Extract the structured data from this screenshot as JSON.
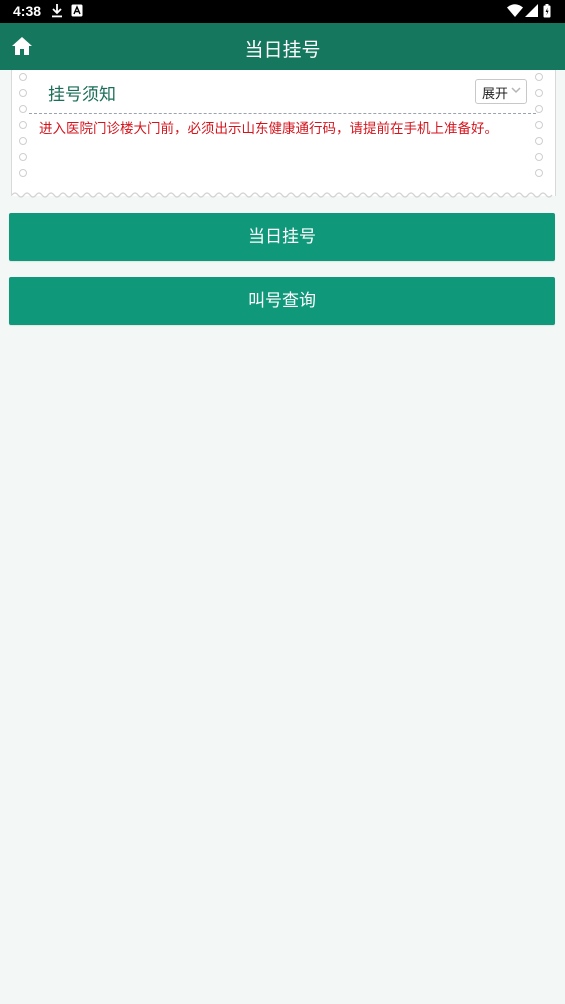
{
  "status_bar": {
    "time": "4:38",
    "icons": [
      "download-icon",
      "a-notification-icon",
      "wifi-icon",
      "signal-icon",
      "battery-icon"
    ]
  },
  "app_bar": {
    "home_icon": "home-icon",
    "title": "当日挂号"
  },
  "notice": {
    "title": "挂号须知",
    "expand_label": "展开",
    "text": "进入医院门诊楼大门前，必须出示山东健康通行码，请提前在手机上准备好。"
  },
  "buttons": {
    "same_day_registration": "当日挂号",
    "queue_query": "叫号查询"
  },
  "colors": {
    "app_bar": "#16775f",
    "button": "#0f987a",
    "notice_title": "#1a6d58",
    "notice_text": "#d4151d",
    "background": "#f3f7f6"
  }
}
